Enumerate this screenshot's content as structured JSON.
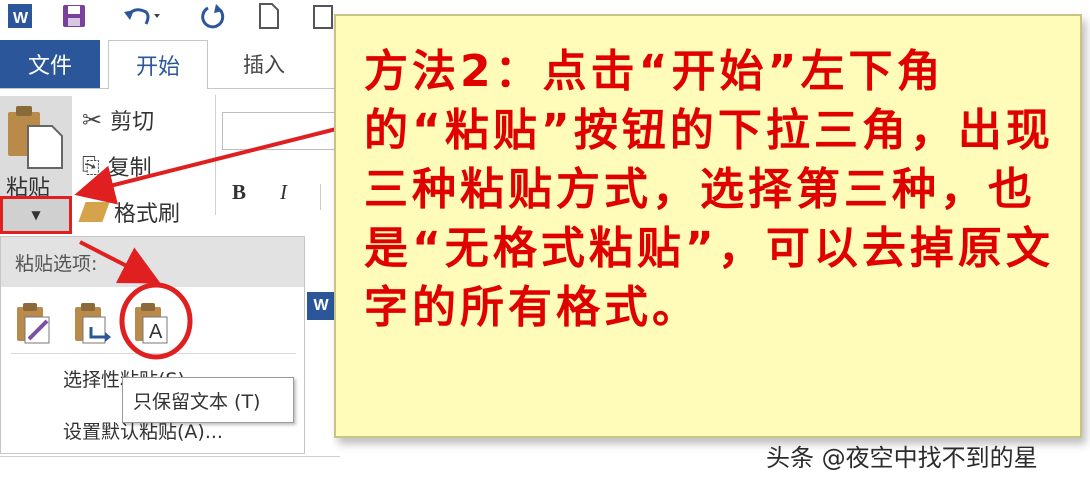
{
  "quick_access": {
    "icons": [
      "word-logo-icon",
      "save-icon",
      "undo-icon",
      "redo-icon",
      "new-document-icon",
      "print-preview-icon"
    ]
  },
  "tabs": {
    "file": "文件",
    "home": "开始",
    "insert": "插入"
  },
  "clipboard": {
    "paste_label": "粘贴",
    "cut_label": "剪切",
    "copy_label": "复制",
    "format_painter_label": "格式刷"
  },
  "font_format": {
    "bold": "B",
    "italic": "I"
  },
  "paste_options": {
    "header": "粘贴选项:",
    "icons": [
      "keep-source-formatting-icon",
      "merge-formatting-icon",
      "keep-text-only-icon"
    ],
    "keep_text_glyph": "A",
    "choose_default": "选择性粘贴(S)...",
    "set_default": "设置默认粘贴(A)...",
    "tooltip": "只保留文本 (T)"
  },
  "note": {
    "text": "方法2：点击“开始”左下角的“粘贴”按钮的下拉三角，出现三种粘贴方式，选择第三种，也是“无格式粘贴”，可以去掉原文字的所有格式。"
  },
  "watermark": "头条 @夜空中找不到的星",
  "colors": {
    "accent": "#2b579a",
    "annotation_red": "#e00000",
    "note_bg": "#fefcb8"
  }
}
